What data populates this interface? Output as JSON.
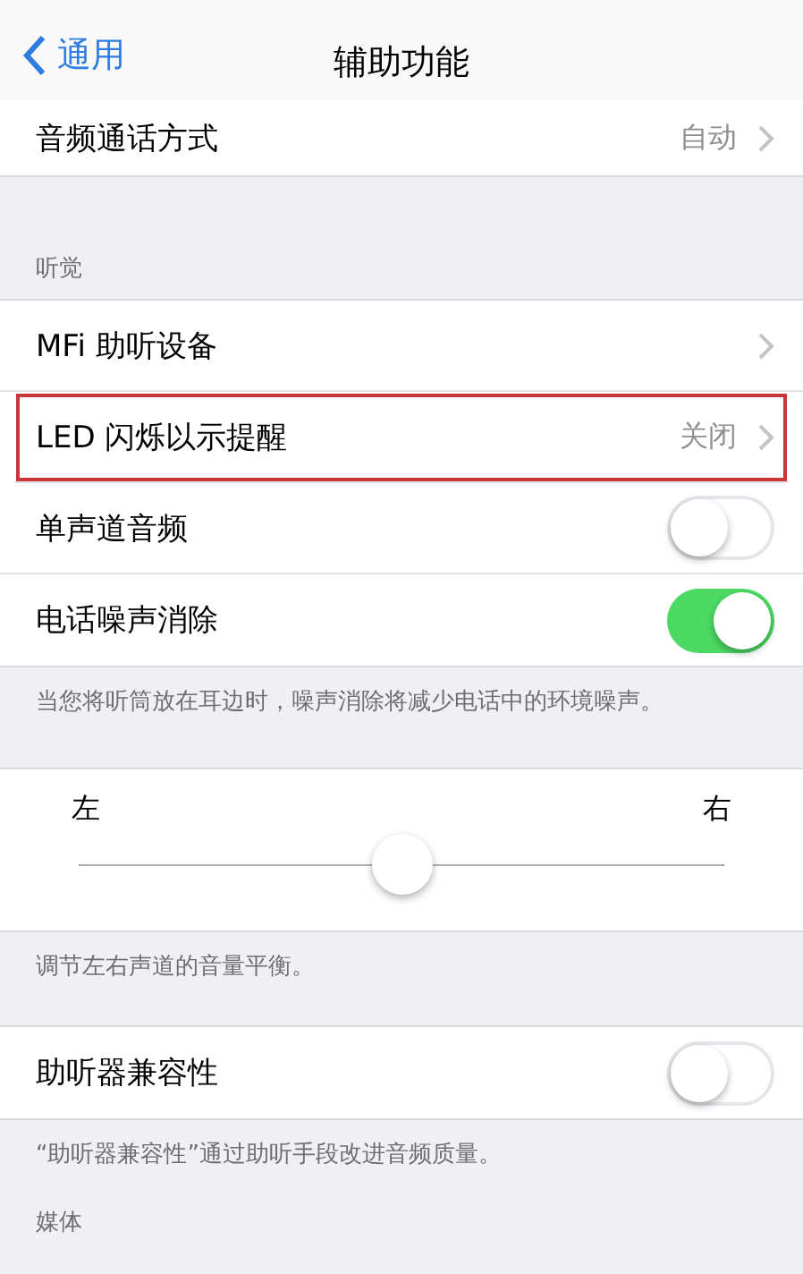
{
  "nav": {
    "back": "通用",
    "title": "辅助功能"
  },
  "top_row": {
    "label": "音频通话方式",
    "value": "自动"
  },
  "hearing": {
    "header": "听觉",
    "rows": [
      {
        "kind": "disclosure",
        "label": "MFi 助听设备",
        "highlighted": false
      },
      {
        "kind": "disclosure",
        "label": "LED 闪烁以示提醒",
        "value": "关闭",
        "highlighted": true
      },
      {
        "kind": "toggle",
        "label": "单声道音频",
        "on": false,
        "highlighted": false
      },
      {
        "kind": "toggle",
        "label": "电话噪声消除",
        "on": true,
        "highlighted": false
      }
    ],
    "footer": "当您将听筒放在耳边时，噪声消除将减少电话中的环境噪声。"
  },
  "balance": {
    "left": "左",
    "right": "右",
    "level": 0.5,
    "footer": "调节左右声道的音量平衡。"
  },
  "compat": {
    "rows": [
      {
        "kind": "toggle",
        "label": "助听器兼容性",
        "on": false,
        "highlighted": false
      }
    ],
    "footer": "“助听器兼容性”通过助听手段改进音频质量。"
  },
  "media": {
    "header": "媒体"
  }
}
